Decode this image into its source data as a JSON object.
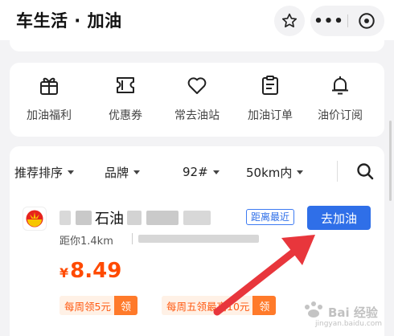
{
  "header": {
    "title": "车生活 · 加油",
    "actions": {
      "favorite": "star-icon",
      "more": "•••",
      "close": "close-circle-icon"
    }
  },
  "nav": {
    "items": [
      {
        "label": "加油福利",
        "icon": "gift-icon"
      },
      {
        "label": "优惠券",
        "icon": "coupon-icon"
      },
      {
        "label": "常去油站",
        "icon": "heart-icon"
      },
      {
        "label": "加油订单",
        "icon": "order-icon"
      },
      {
        "label": "油价订阅",
        "icon": "bell-icon"
      }
    ]
  },
  "filters": {
    "sort": "推荐排序",
    "brand": "品牌",
    "fuel": "92#",
    "range": "50km内"
  },
  "station": {
    "name_visible": "石油",
    "tag": "距离最近",
    "button": "去加油",
    "distance": "距你1.4km",
    "currency": "¥",
    "price": "8.49",
    "coupons": [
      {
        "text": "每周领5元",
        "action": "领"
      },
      {
        "text": "每周五领最高10元",
        "action": "领"
      }
    ]
  },
  "watermark": {
    "text": "Bai 经验",
    "sub": "jingyan.baidu.com"
  },
  "colors": {
    "accent": "#2f6fe8",
    "price": "#ff4a00",
    "arrow": "#e8363c"
  }
}
